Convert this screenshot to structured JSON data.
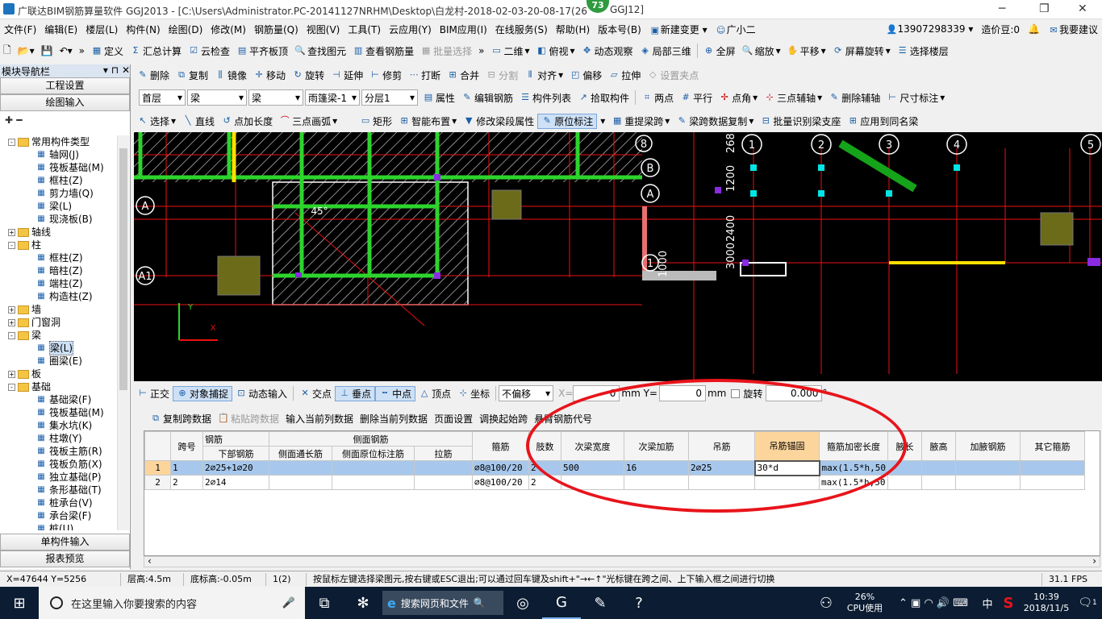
{
  "app": {
    "title": "广联达BIM钢筋算量软件 GGJ2013 - [C:\\Users\\Administrator.PC-20141127NRHM\\Desktop\\白龙村-2018-02-03-20-08-17(26",
    "title_tail": "GGJ12]",
    "badge": "73"
  },
  "menu": [
    "文件(F)",
    "编辑(E)",
    "楼层(L)",
    "构件(N)",
    "绘图(D)",
    "修改(M)",
    "钢筋量(Q)",
    "视图(V)",
    "工具(T)",
    "云应用(Y)",
    "BIM应用(I)",
    "在线服务(S)",
    "帮助(H)",
    "版本号(B)",
    "新建变更",
    "广小二"
  ],
  "menu_right": {
    "phone": "13907298339",
    "cost": "造价豆:0",
    "suggest": "我要建议"
  },
  "toolbar1": [
    "定义",
    "汇总计算",
    "云检查",
    "平齐板顶",
    "查找图元",
    "查看钢筋量",
    "批量选择",
    "二维",
    "俯视",
    "动态观察",
    "局部三维",
    "全屏",
    "缩放",
    "平移",
    "屏幕旋转",
    "选择楼层"
  ],
  "toolbar2": [
    "删除",
    "复制",
    "镜像",
    "移动",
    "旋转",
    "延伸",
    "修剪",
    "打断",
    "合并",
    "分割",
    "对齐",
    "偏移",
    "拉伸",
    "设置夹点"
  ],
  "toolbar3": {
    "floor": "首层",
    "type1": "梁",
    "type2": "梁",
    "name": "雨篷梁-1",
    "layer": "分层1",
    "items": [
      "属性",
      "编辑钢筋",
      "构件列表",
      "拾取构件",
      "两点",
      "平行",
      "点角",
      "三点辅轴",
      "删除辅轴",
      "尺寸标注"
    ]
  },
  "toolbar4": [
    "选择",
    "直线",
    "点加长度",
    "三点画弧",
    "矩形",
    "智能布置",
    "修改梁段属性",
    "原位标注",
    "重提梁跨",
    "梁跨数据复制",
    "批量识别梁支座",
    "应用到同名梁"
  ],
  "panel": {
    "title": "模块导航栏",
    "btn_project": "工程设置",
    "btn_draw": "绘图输入",
    "btn_single": "单构件输入",
    "btn_report": "报表预览"
  },
  "tree": [
    {
      "label": "常用构件类型",
      "level": 0,
      "kind": "folder",
      "tog": "-"
    },
    {
      "label": "轴网(J)",
      "level": 1,
      "kind": "leaf"
    },
    {
      "label": "筏板基础(M)",
      "level": 1,
      "kind": "leaf"
    },
    {
      "label": "框柱(Z)",
      "level": 1,
      "kind": "leaf"
    },
    {
      "label": "剪力墙(Q)",
      "level": 1,
      "kind": "leaf"
    },
    {
      "label": "梁(L)",
      "level": 1,
      "kind": "leaf"
    },
    {
      "label": "现浇板(B)",
      "level": 1,
      "kind": "leaf"
    },
    {
      "label": "轴线",
      "level": 0,
      "kind": "folder",
      "tog": "+"
    },
    {
      "label": "柱",
      "level": 0,
      "kind": "folder",
      "tog": "-"
    },
    {
      "label": "框柱(Z)",
      "level": 1,
      "kind": "leaf"
    },
    {
      "label": "暗柱(Z)",
      "level": 1,
      "kind": "leaf"
    },
    {
      "label": "端柱(Z)",
      "level": 1,
      "kind": "leaf"
    },
    {
      "label": "构造柱(Z)",
      "level": 1,
      "kind": "leaf"
    },
    {
      "label": "墙",
      "level": 0,
      "kind": "folder",
      "tog": "+"
    },
    {
      "label": "门窗洞",
      "level": 0,
      "kind": "folder",
      "tog": "+"
    },
    {
      "label": "梁",
      "level": 0,
      "kind": "folder",
      "tog": "-"
    },
    {
      "label": "梁(L)",
      "level": 1,
      "kind": "leaf",
      "selected": true
    },
    {
      "label": "圈梁(E)",
      "level": 1,
      "kind": "leaf"
    },
    {
      "label": "板",
      "level": 0,
      "kind": "folder",
      "tog": "+"
    },
    {
      "label": "基础",
      "level": 0,
      "kind": "folder",
      "tog": "-"
    },
    {
      "label": "基础梁(F)",
      "level": 1,
      "kind": "leaf"
    },
    {
      "label": "筏板基础(M)",
      "level": 1,
      "kind": "leaf"
    },
    {
      "label": "集水坑(K)",
      "level": 1,
      "kind": "leaf"
    },
    {
      "label": "柱墩(Y)",
      "level": 1,
      "kind": "leaf"
    },
    {
      "label": "筏板主筋(R)",
      "level": 1,
      "kind": "leaf"
    },
    {
      "label": "筏板负筋(X)",
      "level": 1,
      "kind": "leaf"
    },
    {
      "label": "独立基础(P)",
      "level": 1,
      "kind": "leaf"
    },
    {
      "label": "条形基础(T)",
      "level": 1,
      "kind": "leaf"
    },
    {
      "label": "桩承台(V)",
      "level": 1,
      "kind": "leaf"
    },
    {
      "label": "承台梁(F)",
      "level": 1,
      "kind": "leaf"
    },
    {
      "label": "桩(U)",
      "level": 1,
      "kind": "leaf"
    }
  ],
  "canvas_labels": {
    "axis_A": "A",
    "axis_A1": "A1",
    "axis_B": "B",
    "axis_A_right": "A",
    "axis_1": "1",
    "axis_2": "2",
    "axis_3": "3",
    "axis_4": "4",
    "axis_5": "5",
    "axis_8": "8",
    "axis_1_mid": "1",
    "dim_268": "268",
    "dim_1200": "1200",
    "dim_2400": "2400",
    "dim_3000": "3000",
    "dim_1000": "1000",
    "angle": "45°",
    "ucs_y": "Y",
    "ucs_x": "X"
  },
  "snapbar": {
    "items": [
      "正交",
      "对象捕捉",
      "动态输入",
      "交点",
      "垂点",
      "中点",
      "顶点",
      "坐标"
    ],
    "offset": "不偏移",
    "x_label": "X=",
    "x_val": "0",
    "mm1": "mm Y=",
    "y_val": "0",
    "mm2": "mm",
    "rotate": "旋转",
    "rot_val": "0.000",
    "deg": "°"
  },
  "gridtoolbar": [
    "复制跨数据",
    "粘贴跨数据",
    "输入当前列数据",
    "删除当前列数据",
    "页面设置",
    "调换起始跨",
    "悬臂钢筋代号"
  ],
  "table": {
    "h1": [
      "",
      "跨号",
      "钢筋",
      "侧面钢筋",
      "箍筋",
      "肢数",
      "次梁宽度",
      "次梁加筋",
      "吊筋",
      "吊筋锚固",
      "箍筋加密长度",
      "腋长",
      "腋高",
      "加腋钢筋",
      "其它箍筋"
    ],
    "h2": [
      "下部钢筋",
      "侧面通长筋",
      "侧面原位标注筋",
      "拉筋"
    ],
    "rows": [
      [
        "1",
        "1",
        "2⌀25+1⌀20",
        "",
        "",
        "",
        "⌀8@100/20",
        "2",
        "500",
        "16",
        "2⌀25",
        "30*d",
        "max(1.5*h,50",
        "",
        "",
        "",
        ""
      ],
      [
        "2",
        "2",
        "2⌀14",
        "",
        "",
        "",
        "⌀8@100/20",
        "2",
        "",
        "",
        "",
        "",
        "max(1.5*h,50",
        "",
        "",
        "",
        ""
      ]
    ]
  },
  "status": {
    "coords": "X=47644 Y=5256",
    "floor_h": "层高:4.5m",
    "base_h": "底标高:-0.05m",
    "span": "1(2)",
    "hint": "按鼠标左键选择梁图元,按右键或ESC退出;可以通过回车键及shift+\"→←↑\"光标键在跨之间、上下输入框之间进行切换",
    "fps": "31.1 FPS"
  },
  "taskbar": {
    "search": "在这里输入你要搜索的内容",
    "browser": "搜索网页和文件",
    "cpu_pct": "26%",
    "cpu_label": "CPU使用",
    "ime": "中",
    "time": "10:39",
    "date": "2018/11/5",
    "notif": "1"
  },
  "colors": {
    "annotation": "#e8141b",
    "canvas": "#000000",
    "selected_row": "#a7c8ec",
    "selected_header": "#fcd59c"
  }
}
